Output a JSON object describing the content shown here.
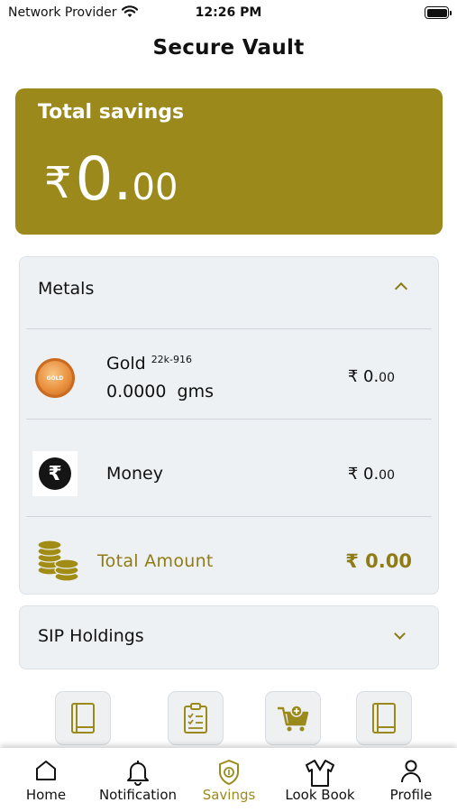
{
  "status_bar": {
    "carrier": "Network Provider",
    "time": "12:26 PM"
  },
  "page_title": "Secure Vault",
  "savings": {
    "label": "Total savings",
    "currency": "₹",
    "amount_int": "0.",
    "amount_dec": "00"
  },
  "metals": {
    "title": "Metals",
    "gold": {
      "icon_text": "GOLD",
      "name": "Gold",
      "purity": "22k-916",
      "quantity": "0.0000 gms",
      "value_main": "₹ 0.",
      "value_dec": "00"
    },
    "money": {
      "icon_symbol": "₹",
      "name": "Money",
      "value_main": "₹ 0.",
      "value_dec": "00"
    },
    "total": {
      "label": "Total Amount",
      "value": "₹ 0.00"
    }
  },
  "sip": {
    "title": "SIP Holdings"
  },
  "quick_actions": [
    {
      "icon": "book-icon"
    },
    {
      "icon": "clipboard-checklist-icon"
    },
    {
      "icon": "cart-add-icon"
    },
    {
      "icon": "book-icon"
    }
  ],
  "nav": {
    "items": [
      {
        "label": "Home",
        "icon": "home-icon",
        "active": false
      },
      {
        "label": "Notification",
        "icon": "bell-icon",
        "active": false
      },
      {
        "label": "Savings",
        "icon": "savings-badge-icon",
        "active": true
      },
      {
        "label": "Look Book",
        "icon": "shirt-icon",
        "active": false
      },
      {
        "label": "Profile",
        "icon": "person-icon",
        "active": false
      }
    ]
  },
  "colors": {
    "accent": "#9b8a1b",
    "accent_text": "#8f7c14",
    "panel_bg": "#eef1f4"
  }
}
